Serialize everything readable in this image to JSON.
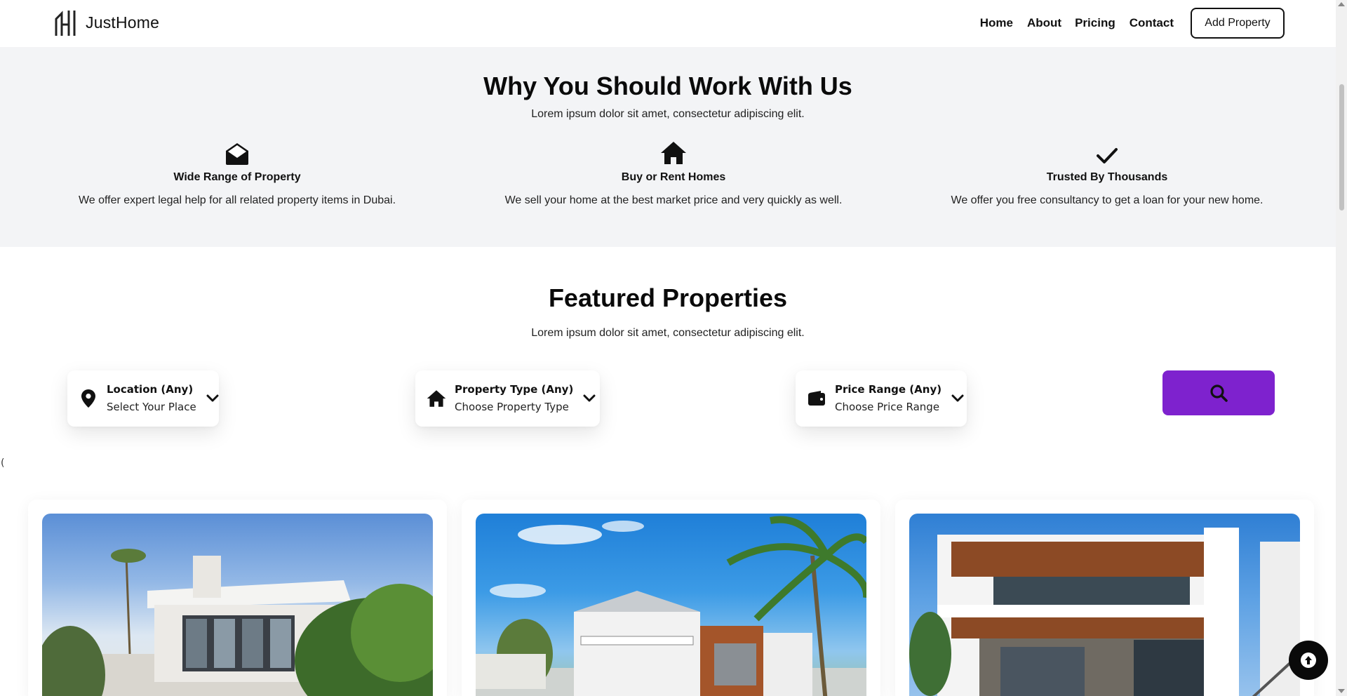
{
  "header": {
    "brand": "JustHome",
    "nav": [
      "Home",
      "About",
      "Pricing",
      "Contact"
    ],
    "add_button": "Add Property"
  },
  "why": {
    "title": "Why You Should Work With Us",
    "subtitle": "Lorem ipsum dolor sit amet, consectetur adipiscing elit.",
    "features": [
      {
        "icon": "envelope-open-icon",
        "title": "Wide Range of Property",
        "desc": "We offer expert legal help for all related property items in Dubai."
      },
      {
        "icon": "house-icon",
        "title": "Buy or Rent Homes",
        "desc": "We sell your home at the best market price and very quickly as well."
      },
      {
        "icon": "check-icon",
        "title": "Trusted By Thousands",
        "desc": "We offer you free consultancy to get a loan for your new home."
      }
    ]
  },
  "featured": {
    "title": "Featured Properties",
    "subtitle": "Lorem ipsum dolor sit amet, consectetur adipiscing elit.",
    "filters": [
      {
        "icon": "location-pin-icon",
        "label": "Location (Any)",
        "value": "Select Your Place"
      },
      {
        "icon": "house-icon",
        "label": "Property Type (Any)",
        "value": "Choose Property Type"
      },
      {
        "icon": "wallet-icon",
        "label": "Price Range (Any)",
        "value": "Choose Price Range"
      }
    ],
    "search_icon": "search-icon",
    "stray_text": "("
  },
  "colors": {
    "accent": "#7e22ce",
    "section_bg": "#f3f4f6",
    "text": "#111111"
  },
  "icons": {
    "scroll_top": "arrow-up-icon",
    "logo": "building-logo-icon"
  }
}
